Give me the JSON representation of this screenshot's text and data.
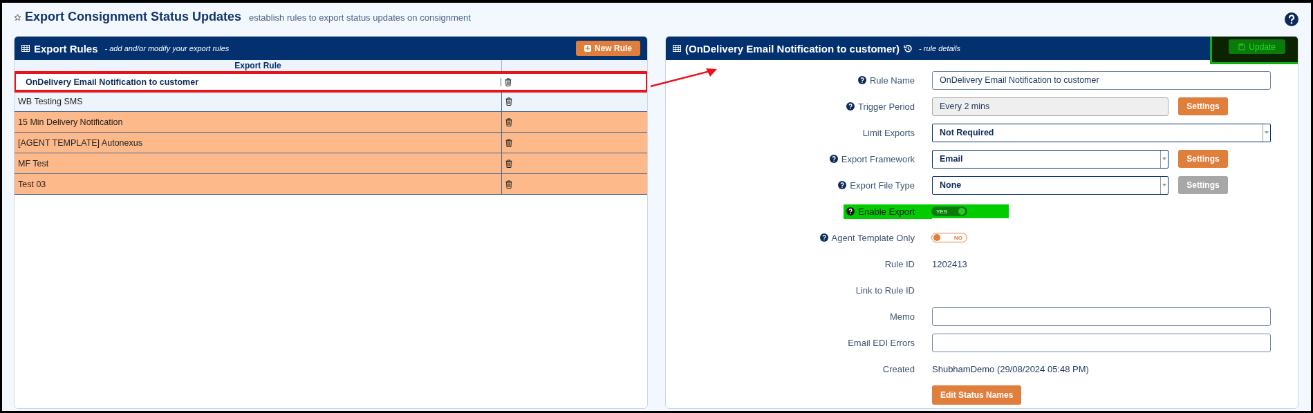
{
  "page": {
    "title": "Export Consignment Status Updates",
    "subtitle": "establish rules to export status updates on consignment"
  },
  "rules_panel": {
    "title": "Export Rules",
    "subtitle": "- add and/or modify your export rules",
    "new_button": "New Rule",
    "table": {
      "columns": [
        "Export Rule"
      ],
      "rows": [
        {
          "name": "OnDelivery Email Notification to customer",
          "selected": true,
          "color": "#ffffff"
        },
        {
          "name": "WB Testing SMS",
          "selected": false,
          "color": "#eef4fb"
        },
        {
          "name": "15 Min Delivery Notification",
          "selected": false,
          "color": "#fdb98a"
        },
        {
          "name": "[AGENT TEMPLATE] Autonexus",
          "selected": false,
          "color": "#fdb98a"
        },
        {
          "name": "MF Test",
          "selected": false,
          "color": "#fdb98a"
        },
        {
          "name": "Test 03",
          "selected": false,
          "color": "#fdb98a"
        }
      ]
    }
  },
  "details_panel": {
    "title": "(OnDelivery Email Notification to customer)",
    "subtitle": "- rule details",
    "update_button": {
      "label": "Update",
      "highlighted": true
    },
    "fields": [
      {
        "kind": "text",
        "label": "Rule Name",
        "help": true,
        "value": "OnDelivery Email Notification to customer"
      },
      {
        "kind": "readonly",
        "label": "Trigger Period",
        "help": true,
        "value": "Every 2 mins",
        "button": {
          "label": "Settings",
          "disabled": false
        }
      },
      {
        "kind": "select",
        "label": "Limit Exports",
        "help": false,
        "value": "Not Required"
      },
      {
        "kind": "select",
        "label": "Export Framework",
        "help": true,
        "value": "Email",
        "button": {
          "label": "Settings",
          "disabled": false
        }
      },
      {
        "kind": "select",
        "label": "Export File Type",
        "help": true,
        "value": "None",
        "button": {
          "label": "Settings",
          "disabled": true
        }
      },
      {
        "kind": "toggle",
        "label": "Enable Export",
        "help": true,
        "on": true,
        "state_label": "YES",
        "highlighted": true
      },
      {
        "kind": "toggle",
        "label": "Agent Template Only",
        "help": true,
        "on": false,
        "state_label": "NO",
        "highlighted": false
      },
      {
        "kind": "value",
        "label": "Rule ID",
        "help": false,
        "value": "1202413"
      },
      {
        "kind": "value",
        "label": "Link to Rule ID",
        "help": false
      },
      {
        "kind": "text",
        "label": "Memo",
        "help": false
      },
      {
        "kind": "text",
        "label": "Email EDI Errors",
        "help": false
      },
      {
        "kind": "value",
        "label": "Created",
        "help": false,
        "value": "ShubhamDemo (29/08/2024 05:48 PM)"
      }
    ],
    "edit_button": "Edit Status Names"
  }
}
